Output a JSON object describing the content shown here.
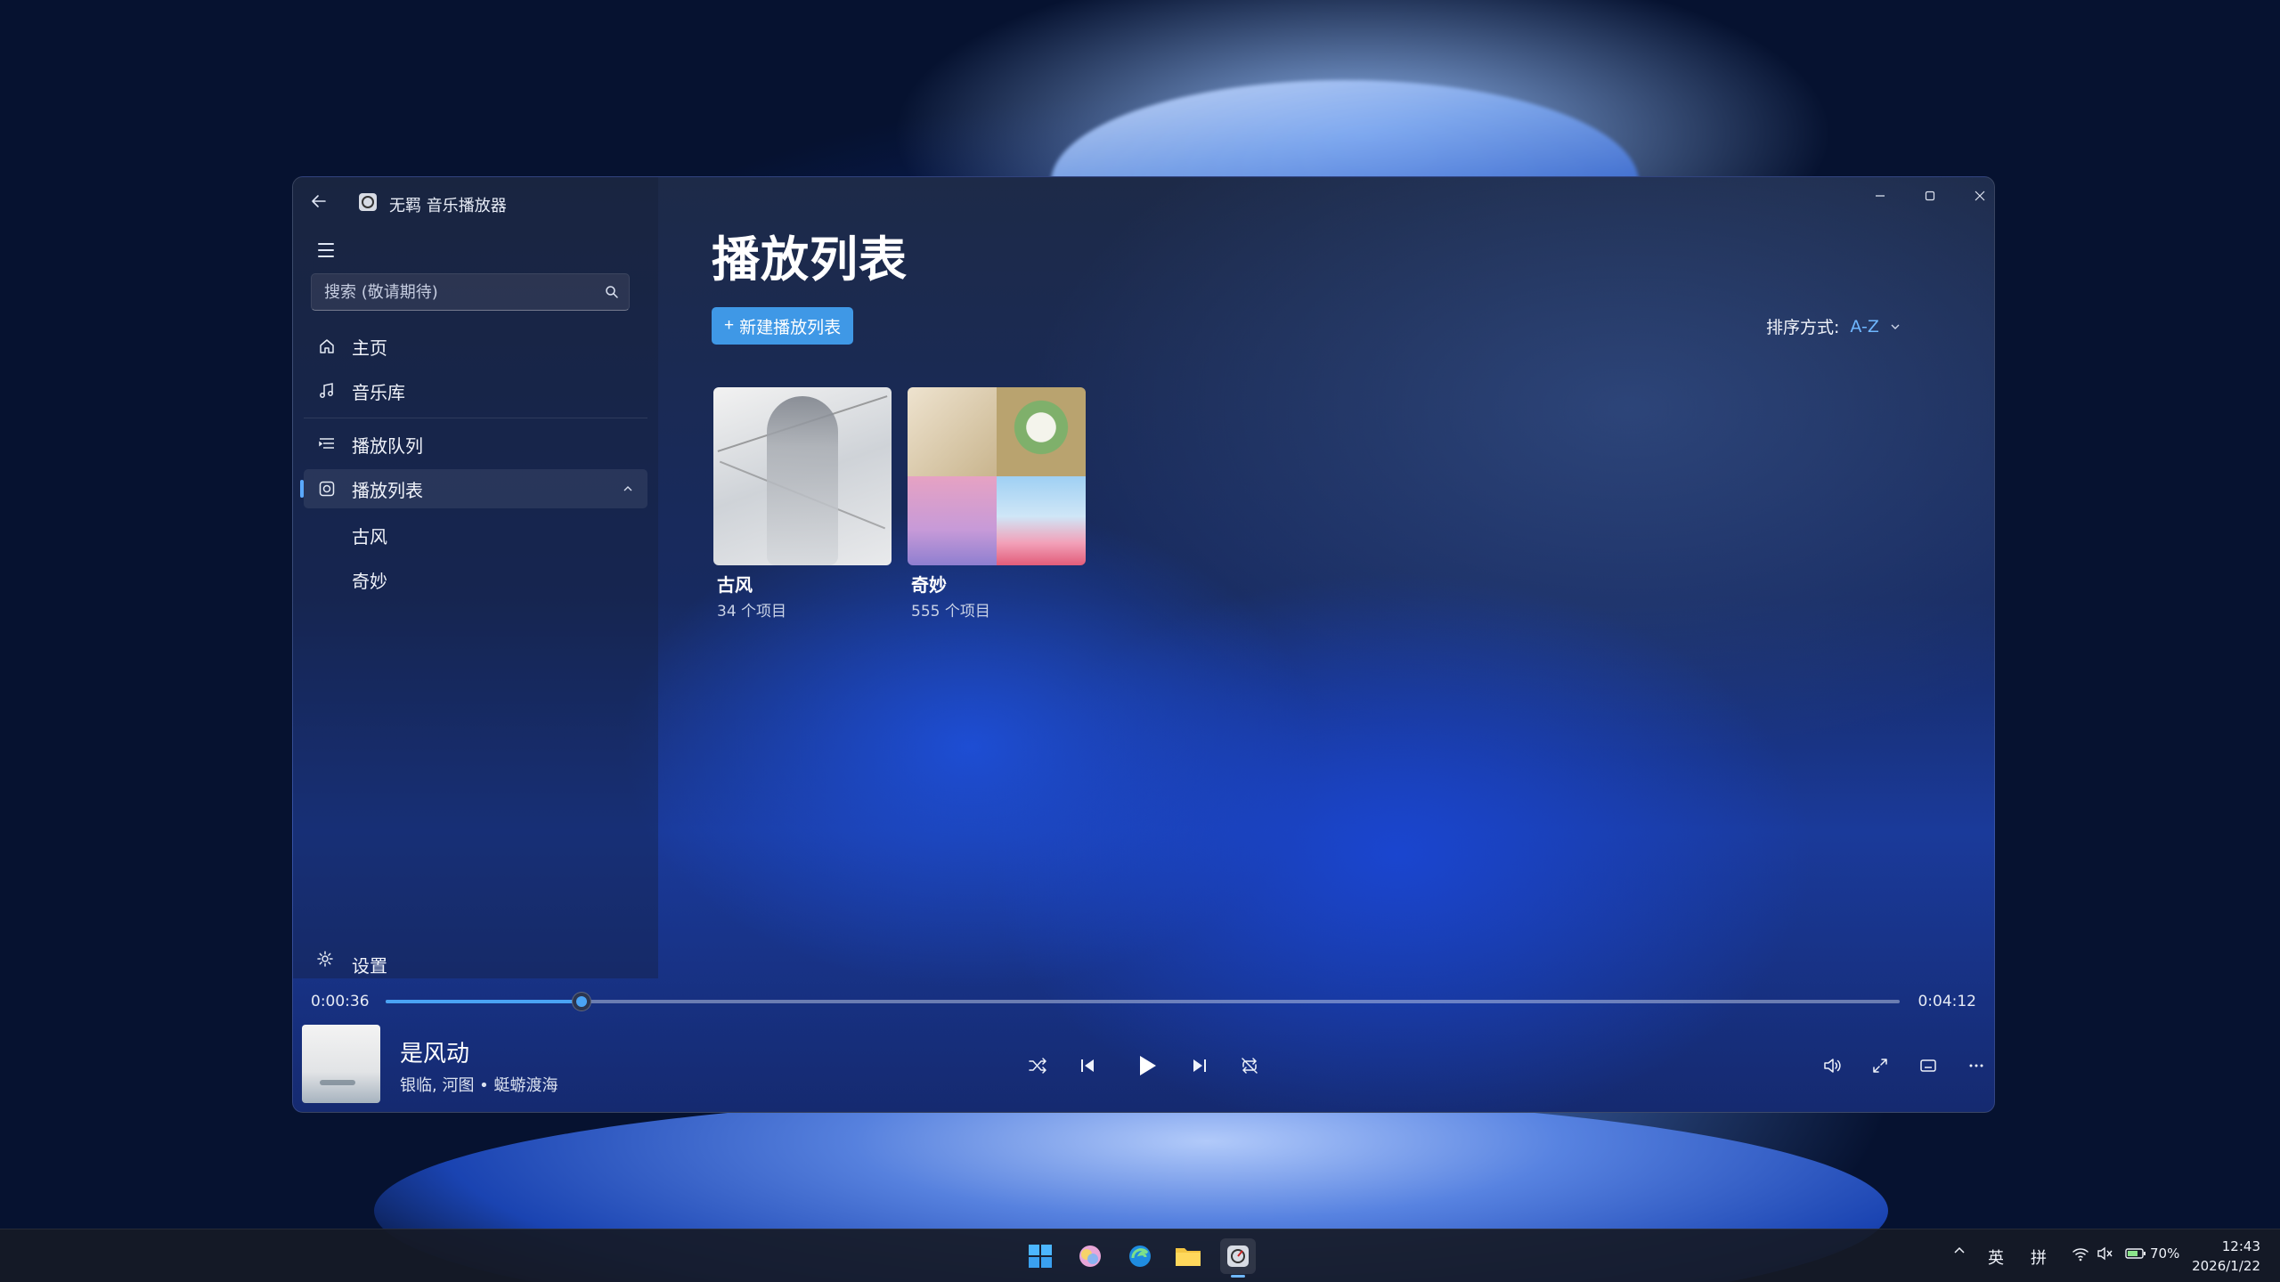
{
  "app": {
    "title": "无羁 音乐播放器"
  },
  "search": {
    "placeholder": "搜索 (敬请期待)"
  },
  "nav": {
    "home": "主页",
    "library": "音乐库",
    "queue": "播放队列",
    "playlists": "播放列表",
    "sub_items": [
      "古风",
      "奇妙"
    ],
    "settings": "设置"
  },
  "page": {
    "title": "播放列表",
    "new_playlist": "新建播放列表",
    "sort_label": "排序方式:",
    "sort_value": "A-Z"
  },
  "playlists": [
    {
      "name": "古风",
      "count": "34 个项目"
    },
    {
      "name": "奇妙",
      "count": "555 个项目"
    }
  ],
  "player": {
    "current_time": "0:00:36",
    "total_time": "0:04:12",
    "progress": 0.1295,
    "song_title": "是风动",
    "song_meta": "银临, 河图 • 蜓蝣渡海"
  },
  "taskbar": {
    "input_lang": "英",
    "input_mode": "拼",
    "battery": "70%",
    "time": "12:43",
    "date": "2026/1/22"
  },
  "colors": {
    "accent": "#4aa3f5",
    "button": "#3f98e6",
    "sort_value": "#6fb7ff"
  }
}
